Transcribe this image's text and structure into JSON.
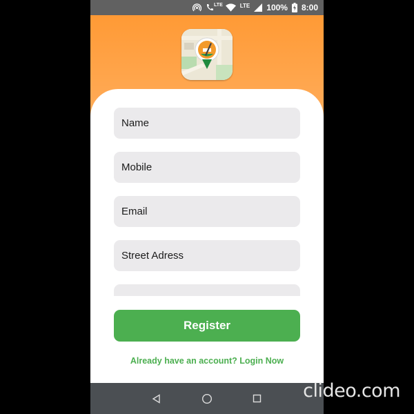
{
  "status_bar": {
    "lte_small": "LTE",
    "lte": "LTE",
    "battery": "100%",
    "time": "8:00",
    "icons": [
      "hotspot-icon",
      "volte-call-icon",
      "wifi-icon",
      "signal-icon",
      "battery-charging-icon"
    ]
  },
  "header": {
    "background_top": "#ff9a35",
    "background_bottom": "#ffb062",
    "logo_icon": "map-pin-logo-icon"
  },
  "form": {
    "fields": [
      {
        "placeholder": "Name"
      },
      {
        "placeholder": "Mobile"
      },
      {
        "placeholder": "Email"
      },
      {
        "placeholder": "Street Adress"
      },
      {
        "placeholder": ""
      }
    ],
    "register_label": "Register",
    "login_text": "Already have an account? Login Now"
  },
  "nav_bar": {
    "icons": [
      "back-triangle-icon",
      "home-circle-icon",
      "recents-square-icon"
    ]
  },
  "watermark": {
    "text": "clideo.com"
  },
  "colors": {
    "accent_green": "#4caf50",
    "field_bg": "#ebeaec",
    "status_bar": "#616161",
    "nav_bar": "#4b4f53"
  }
}
